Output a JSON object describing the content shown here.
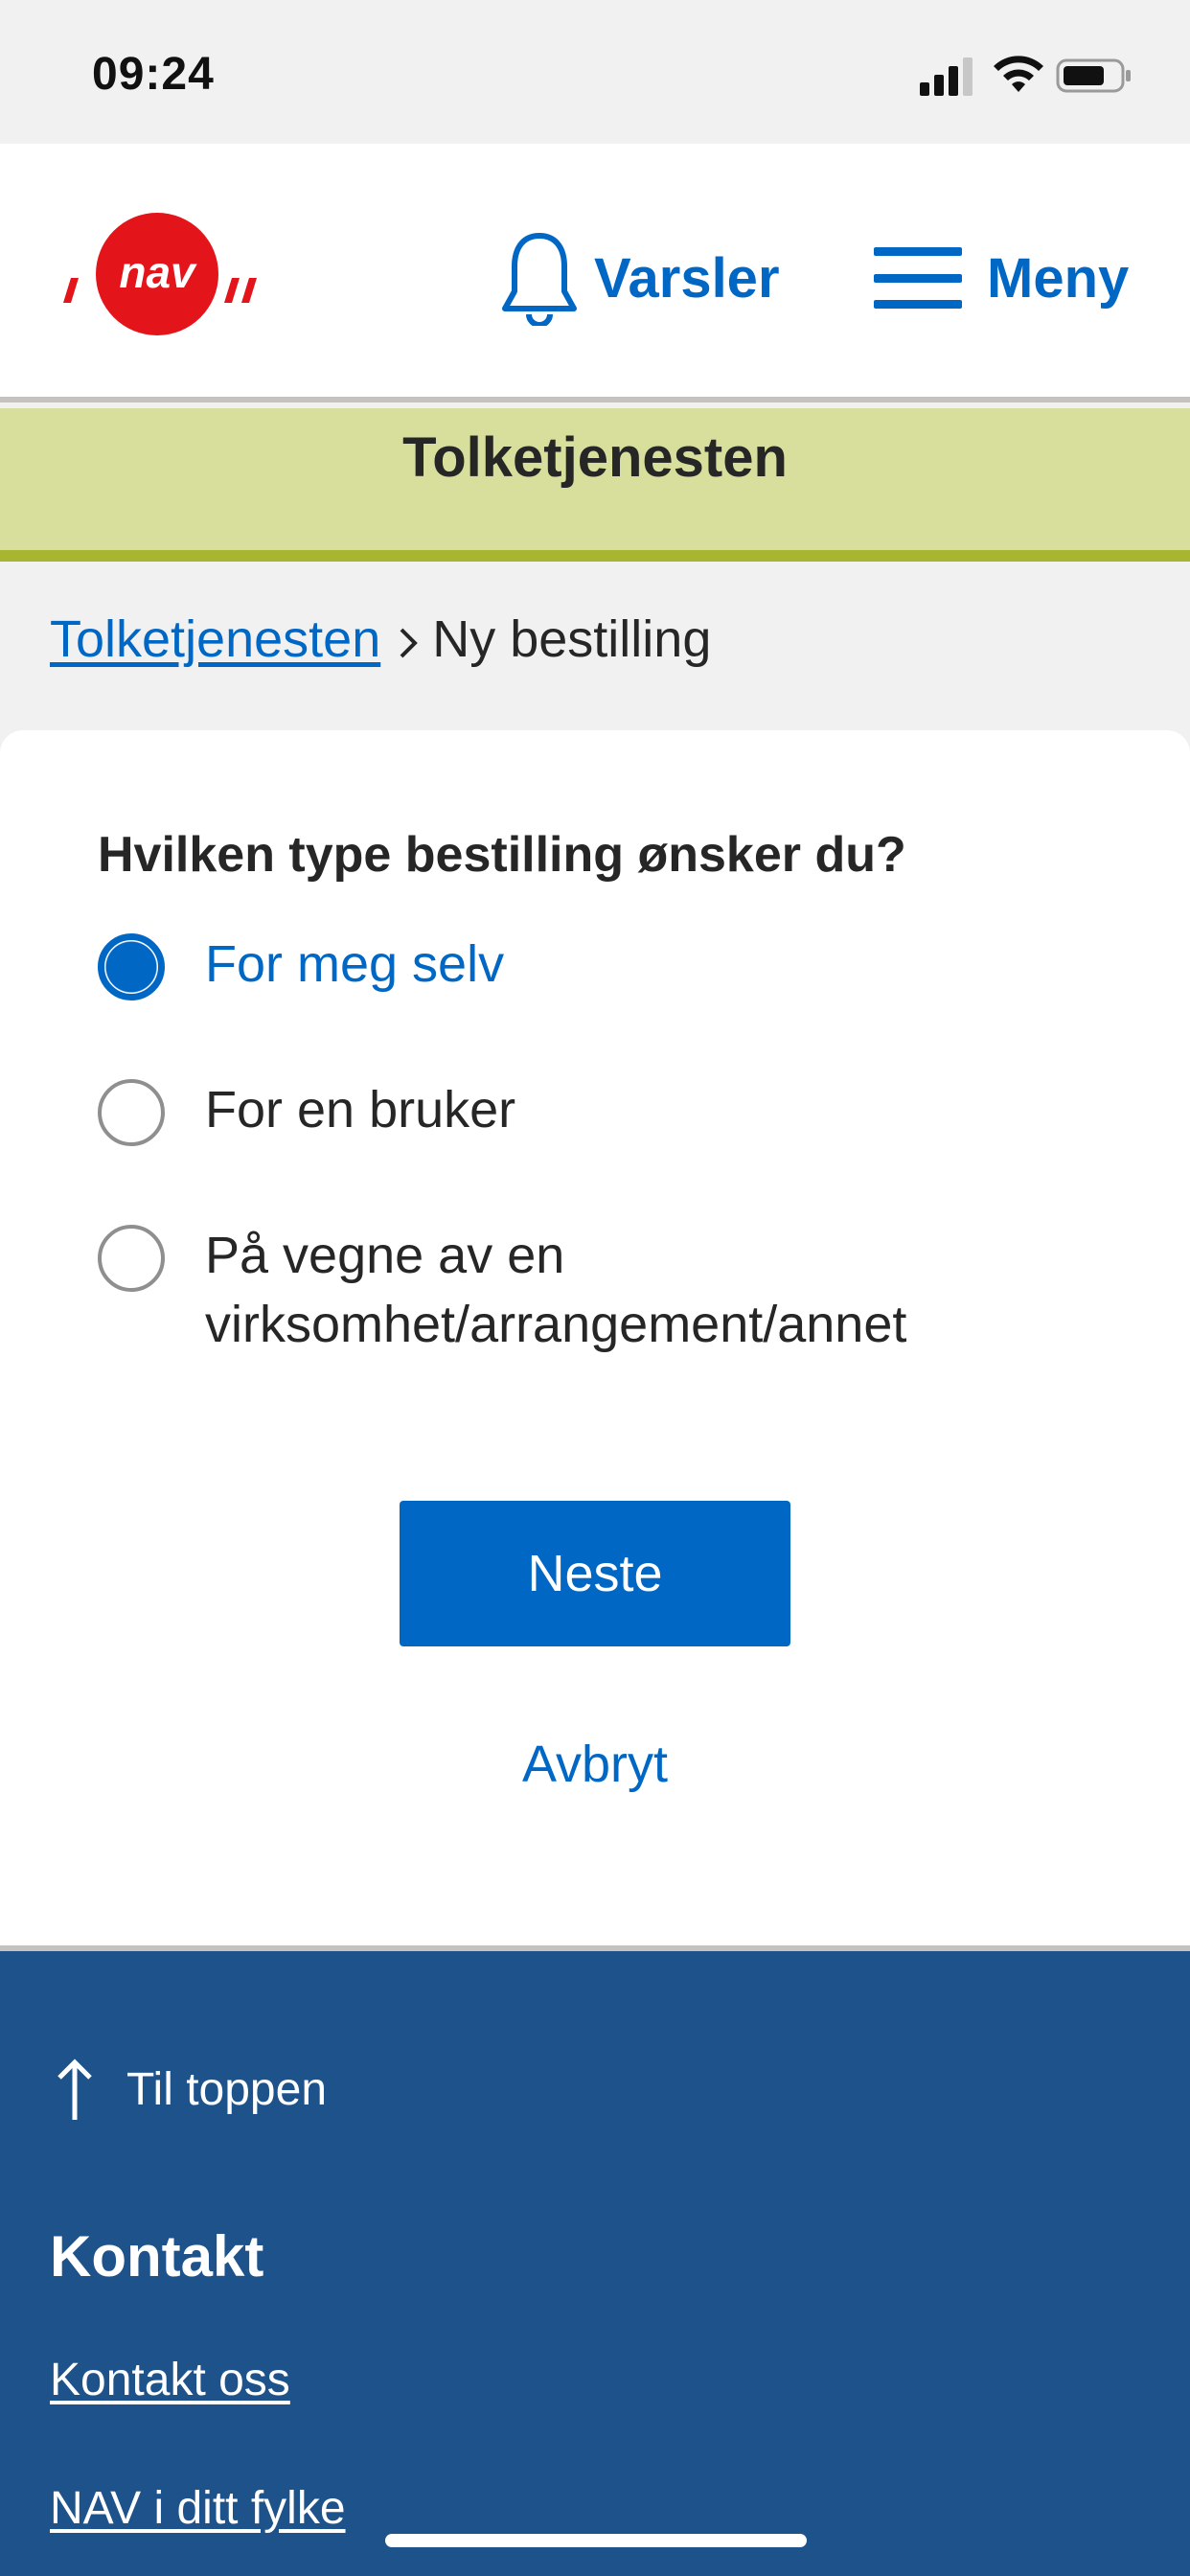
{
  "status_bar": {
    "time": "09:24",
    "icons": [
      "cellular-signal-icon",
      "wifi-icon",
      "battery-icon"
    ]
  },
  "header": {
    "logo_text": "nav",
    "varsler_label": "Varsler",
    "meny_label": "Meny"
  },
  "banner": {
    "title": "Tolketjenesten"
  },
  "breadcrumb": {
    "link_label": "Tolketjenesten",
    "current_label": "Ny bestilling"
  },
  "form": {
    "question": "Hvilken type bestilling ønsker du?",
    "options": [
      {
        "label": "For meg selv",
        "selected": true
      },
      {
        "label": "For en bruker",
        "selected": false
      },
      {
        "label_line1": "På vegne av en",
        "label_line2": "virksomhet/arrangement/annet",
        "selected": false
      }
    ],
    "next_label": "Neste",
    "cancel_label": "Avbryt"
  },
  "footer": {
    "to_top_label": "Til toppen",
    "contact_heading": "Kontakt",
    "links": [
      "Kontakt oss",
      "NAV i ditt fylke"
    ]
  },
  "colors": {
    "accent": "#0067c5",
    "banner_bg": "#d8df9c",
    "banner_border": "#a8b530",
    "footer_bg": "#1d528b",
    "logo_red": "#e4141b"
  }
}
